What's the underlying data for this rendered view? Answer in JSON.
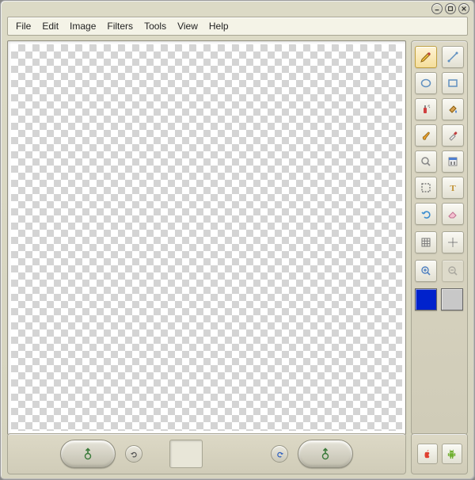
{
  "menu": {
    "file": "File",
    "edit": "Edit",
    "image": "Image",
    "filters": "Filters",
    "tools": "Tools",
    "view": "View",
    "help": "Help"
  },
  "tools": [
    {
      "name": "pencil",
      "selected": true
    },
    {
      "name": "line",
      "selected": false
    },
    {
      "name": "ellipse",
      "selected": false
    },
    {
      "name": "rectangle",
      "selected": false
    },
    {
      "name": "spray",
      "selected": false
    },
    {
      "name": "fill",
      "selected": false
    },
    {
      "name": "brush",
      "selected": false
    },
    {
      "name": "eyedropper",
      "selected": false
    },
    {
      "name": "zoom",
      "selected": false
    },
    {
      "name": "color-adjust",
      "selected": false
    },
    {
      "name": "select",
      "selected": false
    },
    {
      "name": "text",
      "selected": false
    },
    {
      "name": "undo",
      "selected": false
    },
    {
      "name": "eraser",
      "selected": false
    }
  ],
  "view_tools": [
    {
      "name": "grid-toggle",
      "enabled": true
    },
    {
      "name": "crosshair",
      "enabled": true
    },
    {
      "name": "zoom-in",
      "enabled": true
    },
    {
      "name": "zoom-out",
      "enabled": false
    }
  ],
  "colors": {
    "foreground": "#0022cc",
    "background": "#c8c8c8"
  },
  "bottom": {
    "undo_tip": "Undo",
    "redo_tip": "Redo",
    "prev_tip": "Previous",
    "next_tip": "Next"
  },
  "platforms": {
    "apple": "Apple",
    "android": "Android"
  }
}
